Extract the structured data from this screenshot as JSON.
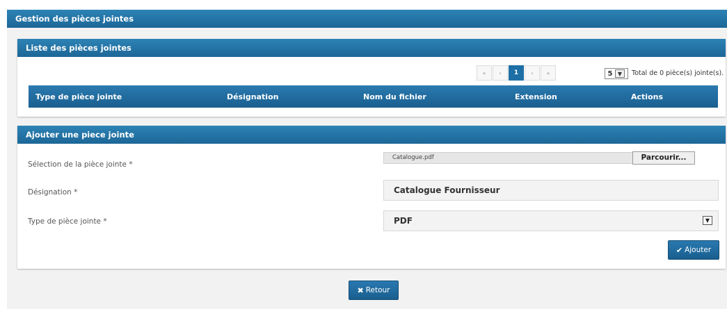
{
  "page": {
    "title": "Gestion des pièces jointes"
  },
  "list_panel": {
    "title": "Liste des pièces jointes",
    "pagination": {
      "first_icon": "«",
      "prev_icon": "‹",
      "current_page": "1",
      "next_icon": "›",
      "last_icon": "»"
    },
    "page_size": "5",
    "total_text": "Total de 0 pièce(s) jointe(s).",
    "columns": [
      "Type de pièce jointe",
      "Désignation",
      "Nom du fichier",
      "Extension",
      "Actions"
    ],
    "rows": []
  },
  "add_panel": {
    "title": "Ajouter une piece jointe",
    "file_label": "Sélection de la pièce jointe *",
    "file_value": "Catalogue.pdf",
    "browse_label": "Parcourir...",
    "designation_label": "Désignation *",
    "designation_value": "Catalogue Fournisseur",
    "type_label": "Type de pièce jointe *",
    "type_value": "PDF",
    "add_label": "Ajouter"
  },
  "footer": {
    "back_label": "Retour"
  },
  "icons": {
    "add": "check-icon",
    "back": "times-icon",
    "select": "chevron-down-icon"
  },
  "colors": {
    "header": "#1c6697",
    "accent": "#1d6fa5"
  }
}
